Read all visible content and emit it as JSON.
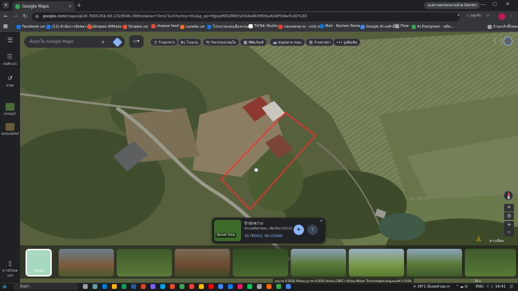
{
  "browser": {
    "tab_title": "Google Maps",
    "new_tab": "+",
    "url_prefix": "google.com",
    "url_rest": "/maps/@18.7655254,99.1319546,168m/data=!3m1!1e3?entry=ttu&g_ep=EgoyMDI2MDYyOS4wIKXMDSoASAFQAw%3D%3D",
    "gemini_label": "จะสถานครบบบถามด้วย Gemini",
    "profile_label": "หยุดชั่ว",
    "all_bookmarks": "บ้านเกล้าทั้งหมด"
  },
  "bookmarks": [
    {
      "label": "Facebook  แซ",
      "color": "#1877f2"
    },
    {
      "label": "(12) ตัวนัดการสัดพลางใน...",
      "color": "#1877f2"
    },
    {
      "label": "Shopee Affiliate แซ",
      "color": "#ee4d2d"
    },
    {
      "label": "Shopee แซ",
      "color": "#ee4d2d"
    },
    {
      "label": "shopee food",
      "color": "#ee4d2d"
    },
    {
      "label": "Lazada แซ",
      "color": "#f57224"
    },
    {
      "label": "โปรแกรมเล่นเมืองกรอง...",
      "color": "#1a73e8"
    },
    {
      "label": "TikTok Studio",
      "color": "#ffffff"
    },
    {
      "label": "กล่องจดหมาย - nick.m...",
      "color": "#ea4335"
    },
    {
      "label": "Mail - Kochen Pania...",
      "color": "#0078d4"
    },
    {
      "label": "Google AI ลงตัวนิ้น",
      "color": "#4285f4"
    },
    {
      "label": "Flow",
      "color": "#9aa0a6"
    },
    {
      "label": "Ai Evergreen - พลิค...",
      "color": "#34a853"
    }
  ],
  "sidebar": {
    "saved": "บันทึกแล้ว",
    "recent": "ล่าสุด",
    "recent_place_1": "แกนบุญฯ",
    "recent_place_2": "นลรุณวัตยันใ",
    "app_download": "ดาวน์โหลดแอป"
  },
  "search": {
    "placeholder": "ค้นหาใน Google Maps"
  },
  "chips": [
    {
      "icon": "🍴",
      "label": "ร้านอาหาร"
    },
    {
      "icon": "🛏",
      "label": "โรงแรม"
    },
    {
      "icon": "📷",
      "label": "กิจกรรมน่าสนใจ"
    },
    {
      "icon": "🏛",
      "label": "พิพิธภัณฑ์"
    },
    {
      "icon": "🚌",
      "label": "ขนส่งสาธารณะ"
    },
    {
      "icon": "🛍",
      "label": "ร้านขายยา"
    },
    {
      "icon": "•••",
      "label": "ดูเพิ่มเติม"
    }
  ],
  "place_card": {
    "title": "บ้านักชว่าง",
    "subtitle": "อำเภอสันป่าตอง, เชียงใหม่ 50120",
    "coords": "18.765452, 99.131946",
    "street_view": "Street View",
    "close": "×"
  },
  "map": {
    "layer_label": "เลเยอร์",
    "satellite_label": "ดาวเทียม",
    "attribution": "ลูกมาพ ©2026 Airbus,ภูภาพ ©2026 Airbus,CNES / Airbus,Maxar Technologies,ข้อมูลแผนที่ ©2026",
    "scale": "20 ม.",
    "zoom_in": "+",
    "zoom_out": "−"
  },
  "taskbar": {
    "search_placeholder": "ค้นหา",
    "weather": "28°C มีแดดส่วนมาก",
    "lang": "ENG",
    "time": "18:41"
  }
}
